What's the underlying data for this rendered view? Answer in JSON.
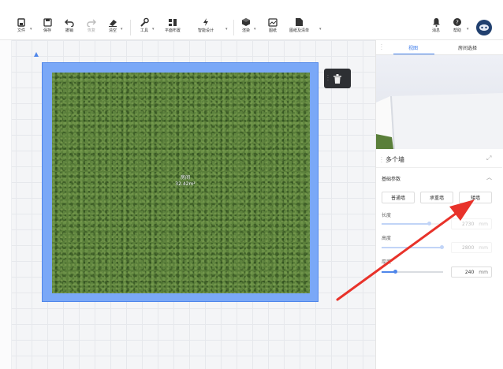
{
  "toolbar": {
    "file": "文件",
    "save": "保存",
    "undo": "撤销",
    "redo": "恢复",
    "clear": "清空",
    "tools": "工具",
    "floor_layout": "平面布置",
    "smart_design": "智能设计",
    "render": "渲染",
    "drawings": "图纸",
    "drawing_list": "图纸及清单",
    "messages": "消息",
    "help": "帮助"
  },
  "canvas": {
    "room_name": "房间",
    "room_area": "32.42m²"
  },
  "panel": {
    "tabs": [
      "视图",
      "房间选择"
    ],
    "active_tab": 0,
    "section_title": "多个墙",
    "basic_params": "基础参数",
    "wall_types": [
      "普通墙",
      "承重墙",
      "矮墙"
    ],
    "fields": {
      "length": {
        "label": "长度",
        "value": "2730",
        "unit": "mm"
      },
      "height": {
        "label": "高度",
        "value": "2800",
        "unit": "mm"
      },
      "thickness": {
        "label": "厚度",
        "value": "240",
        "unit": "mm"
      }
    }
  },
  "colors": {
    "accent": "#3b7bea",
    "wall": "#7aa8f7",
    "arrow": "#e8322a"
  }
}
